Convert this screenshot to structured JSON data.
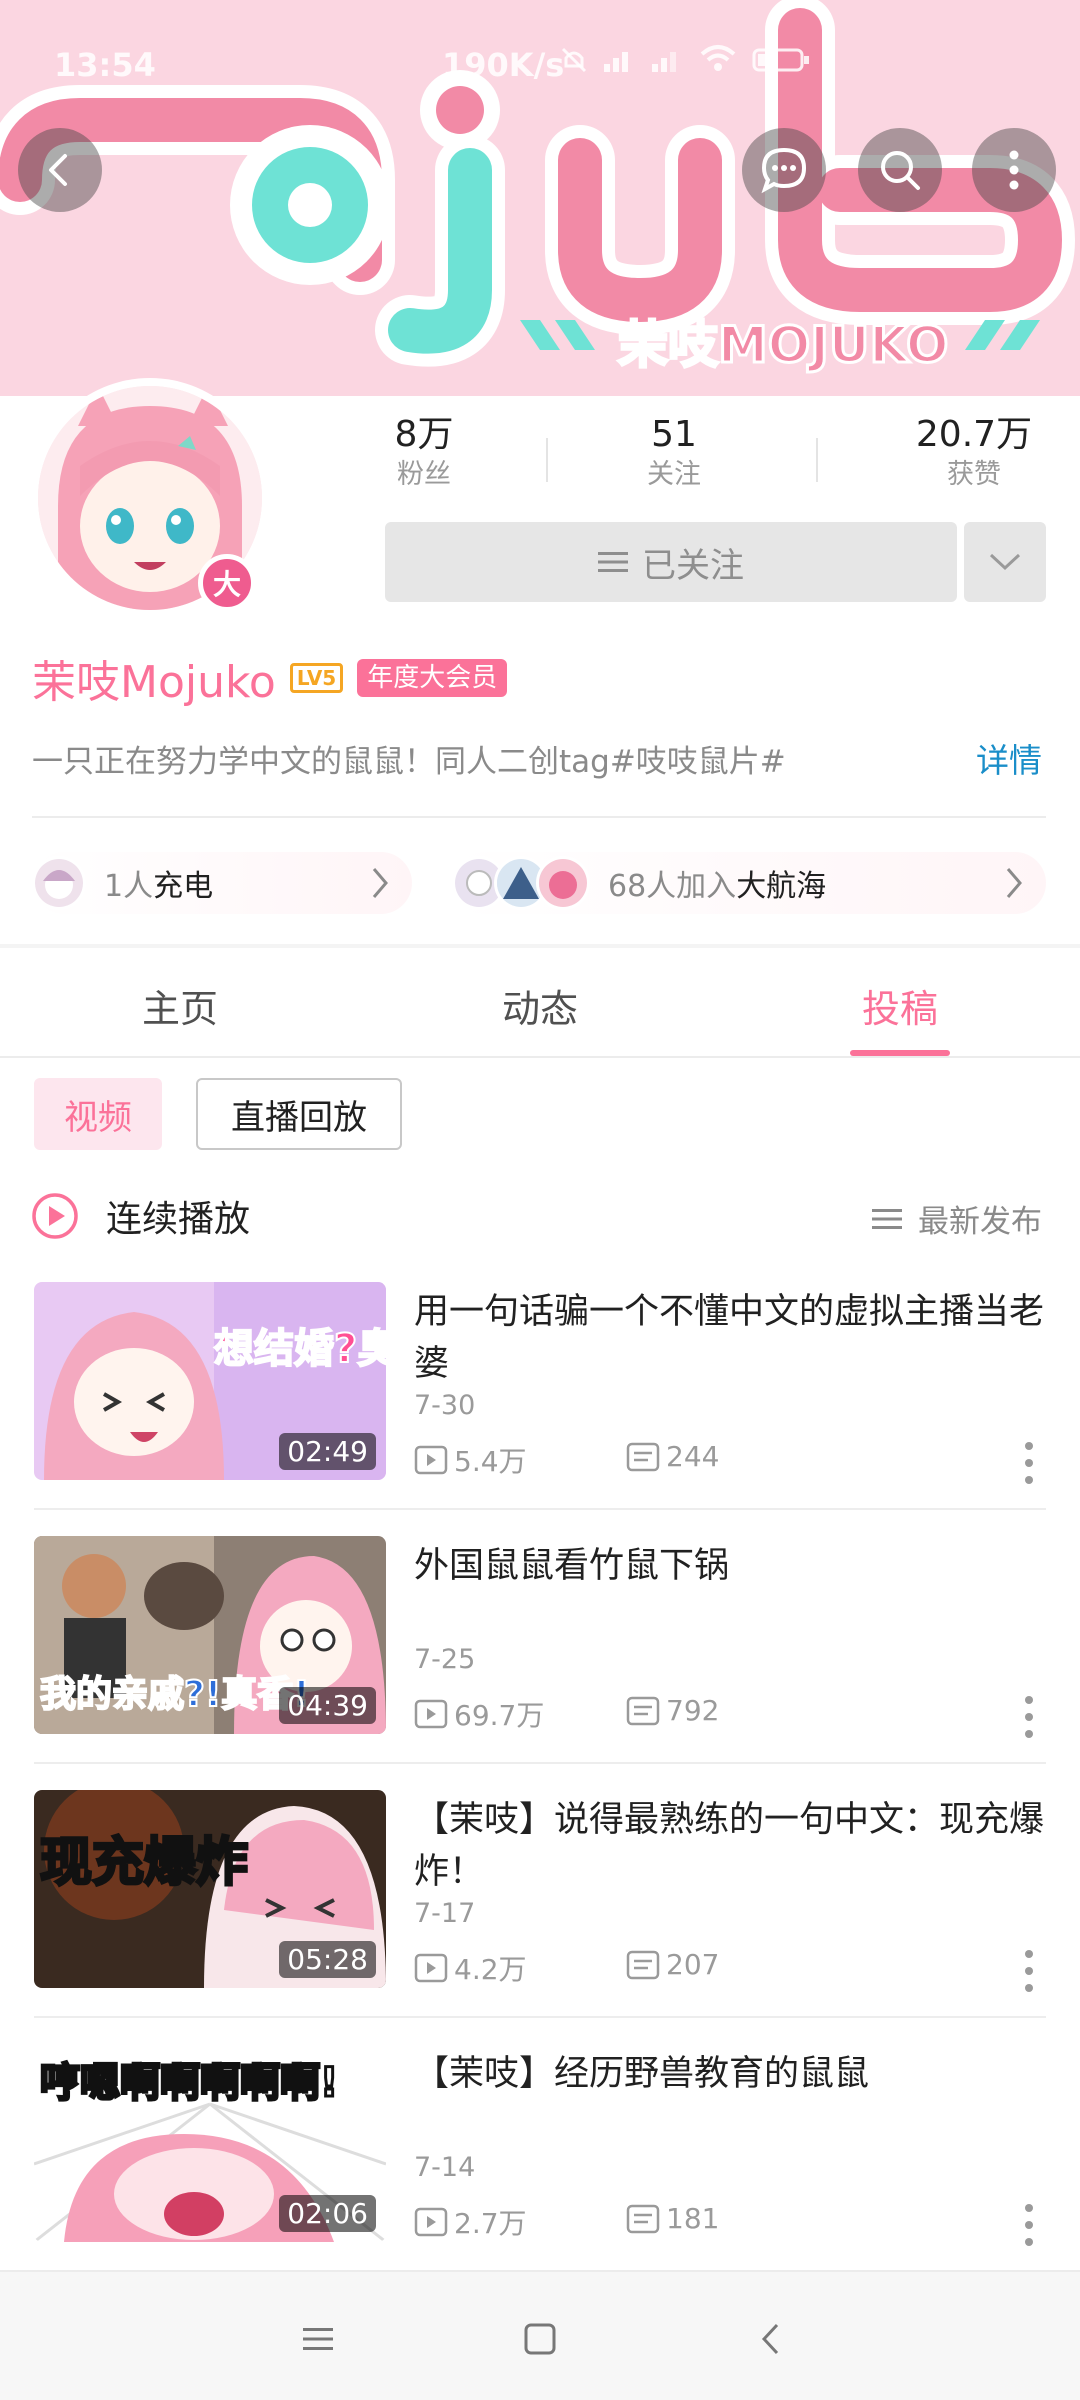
{
  "status_bar": {
    "time": "13:54",
    "net_speed": "190K/s"
  },
  "banner": {
    "logo_text": "mojuko",
    "subtitle": "茉吱MOJUKO"
  },
  "profile": {
    "avatar_badge": "大",
    "stats": [
      {
        "value": "8万",
        "label": "粉丝"
      },
      {
        "value": "51",
        "label": "关注"
      },
      {
        "value": "20.7万",
        "label": "获赞"
      }
    ],
    "follow_button": "已关注",
    "name": "茉吱Mojuko",
    "level": "LV5",
    "vip": "年度大会员",
    "bio": "一只正在努力学中文的鼠鼠！同人二创tag#吱吱鼠片#",
    "detail_link": "详情",
    "charge": {
      "count_text": "1人",
      "label": "充电"
    },
    "fleet": {
      "count_text": "68人加入",
      "label": "大航海"
    }
  },
  "tabs": [
    {
      "label": "主页"
    },
    {
      "label": "动态"
    },
    {
      "label": "投稿"
    }
  ],
  "active_tab": "投稿",
  "filters": {
    "video": "视频",
    "live_replay": "直播回放"
  },
  "playback": {
    "continuous": "连续播放",
    "sort": "最新发布"
  },
  "videos": [
    {
      "title": "用一句话骗一个不懂中文的虚拟主播当老婆",
      "date": "7-30",
      "views": "5.4万",
      "danmaku": "244",
      "duration": "02:49",
      "thumb_text": "想结婚?臭老公!"
    },
    {
      "title": "外国鼠鼠看竹鼠下锅",
      "date": "7-25",
      "views": "69.7万",
      "danmaku": "792",
      "duration": "04:39",
      "thumb_text": "我的亲戚?!真香!"
    },
    {
      "title": "【茉吱】说得最熟练的一句中文：现充爆炸！",
      "date": "7-17",
      "views": "4.2万",
      "danmaku": "207",
      "duration": "05:28",
      "thumb_text": "现充爆炸"
    },
    {
      "title": "【茉吱】经历野兽教育的鼠鼠",
      "date": "7-14",
      "views": "2.7万",
      "danmaku": "181",
      "duration": "02:06",
      "thumb_text": "哼嗯啊啊啊啊啊!"
    }
  ],
  "colors": {
    "accent": "#fb7299",
    "link": "#1a8ec9",
    "banner_bg": "#fbd6e1",
    "teal": "#6ee2d5"
  }
}
